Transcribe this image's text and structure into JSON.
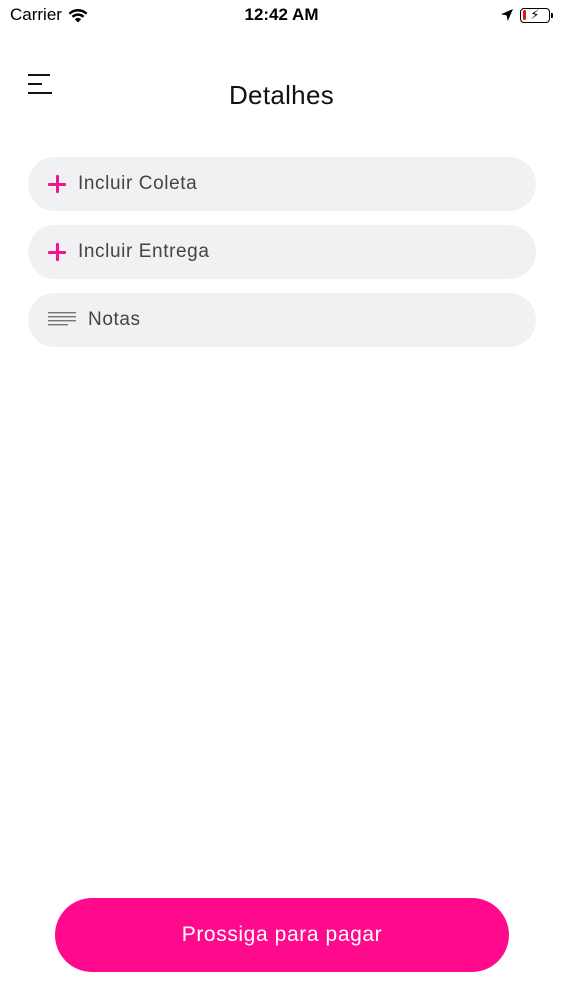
{
  "status_bar": {
    "carrier": "Carrier",
    "time": "12:42 AM",
    "battery_level": 0.15,
    "battery_color": "#e0141e"
  },
  "header": {
    "menu_icon": "hamburger-menu-icon",
    "title": "Detalhes"
  },
  "actions": [
    {
      "icon": "plus-icon",
      "label": "Incluir Coleta"
    },
    {
      "icon": "plus-icon",
      "label": "Incluir Entrega"
    },
    {
      "icon": "notes-icon",
      "label": "Notas"
    }
  ],
  "footer": {
    "cta_label": "Prossiga para pagar"
  },
  "colors": {
    "accent": "#ff0a8c",
    "pill_background": "#f1f0f3",
    "text": "#444444"
  }
}
